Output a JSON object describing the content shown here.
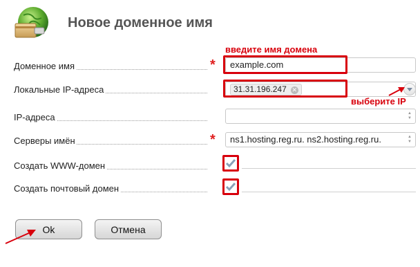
{
  "header": {
    "title": "Новое доменное имя",
    "icon": "globe-package-icon"
  },
  "annotations": {
    "enter_domain": "введите имя домена",
    "choose_ip": "выберите IP",
    "highlight_color": "#d8000c"
  },
  "form": {
    "domain": {
      "label": "Доменное имя",
      "value": "example.com",
      "required": true
    },
    "local_ips": {
      "label": "Локальные IP-адреса",
      "selected": "31.31.196.247"
    },
    "ip_addresses": {
      "label": "IP-адреса",
      "value": ""
    },
    "nameservers": {
      "label": "Серверы имён",
      "value": "ns1.hosting.reg.ru. ns2.hosting.reg.ru.",
      "required": true
    },
    "www_domain": {
      "label": "Создать WWW-домен",
      "checked": true
    },
    "mail_domain": {
      "label": "Создать почтовый домен",
      "checked": true
    }
  },
  "buttons": {
    "ok": "Ok",
    "cancel": "Отмена"
  }
}
